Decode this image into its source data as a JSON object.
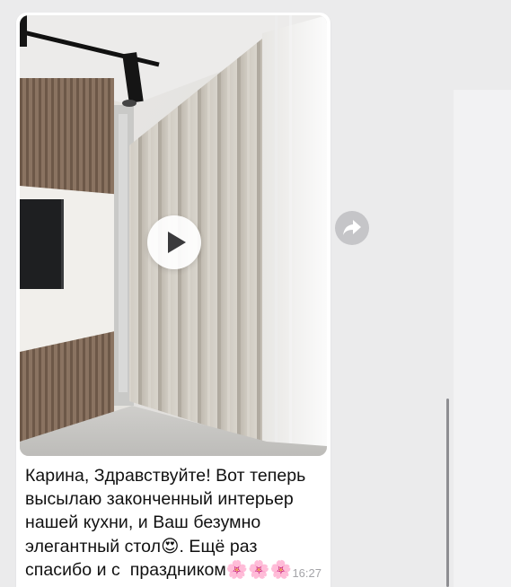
{
  "message": {
    "caption": "Карина, Здравствуйте! Вот теперь\nвысылаю законченный интерьер\nнашей кухни, и Ваш безумно\nэлегантный стол😍. Ещё раз\nспасибо и с  праздником🌸🌸🌸",
    "time": "16:27",
    "media_type": "video"
  },
  "icons": {
    "play": "play-icon",
    "forward": "forward-arrow-icon"
  },
  "colors": {
    "bubble": "#ffffff",
    "background": "#ebebec",
    "forward_button": "#c5c5c8",
    "timestamp": "#a4a4a8"
  }
}
